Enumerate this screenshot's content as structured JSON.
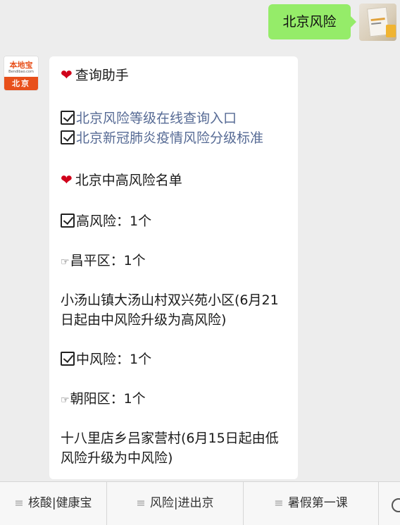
{
  "outgoing": {
    "text": "北京风险"
  },
  "bot": {
    "logo_main": "本地宝",
    "logo_sub": "Bendibao.com",
    "logo_city": "北京"
  },
  "message": {
    "section1_title": "查询助手",
    "link1": "北京风险等级在线查询入口",
    "link2": "北京新冠肺炎疫情风险分级标准",
    "section2_title": "北京中高风险名单",
    "high_risk": "高风险：1个",
    "district1": "昌平区：1个",
    "area1": "小汤山镇大汤山村双兴苑小区(6月21日起由中风险升级为高风险)",
    "mid_risk": "中风险：1个",
    "district2": "朝阳区：1个",
    "area2": "十八里店乡吕家营村(6月15日起由低风险升级为中风险)"
  },
  "menu": [
    {
      "label": "核酸|健康宝"
    },
    {
      "label": "风险|进出京"
    },
    {
      "label": "暑假第一课"
    }
  ],
  "colors": {
    "outgoing_bubble": "#95ec69",
    "link": "#576b95",
    "heart": "#d0021b",
    "brand": "#e8501b"
  }
}
